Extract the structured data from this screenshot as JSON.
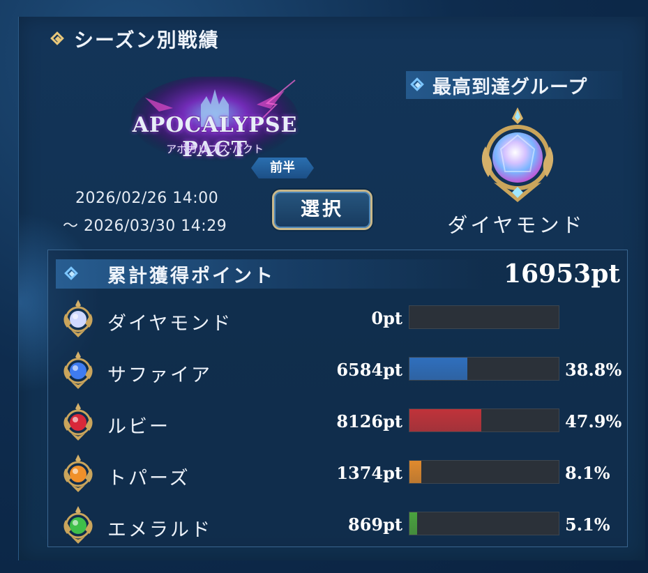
{
  "section_title": "シーズン別戦績",
  "season": {
    "logo_title": "APOCALYPSE PACT",
    "logo_subtitle": "アポカリプス·パクト",
    "half_badge": "前半",
    "start": "2026/02/26 14:00",
    "end": "～ 2026/03/30 14:29",
    "select_button": "選択"
  },
  "highest_group": {
    "label": "最高到達グループ",
    "name": "ダイヤモンド",
    "icon": "diamond-rank-emblem-icon"
  },
  "points": {
    "label": "累計獲得ポイント",
    "total": "16953pt",
    "ranks": [
      {
        "name": "ダイヤモンド",
        "points": "0pt",
        "percent": "",
        "fraction": 0.0,
        "color": "#9aa0aa",
        "gem": "#cfd8ff",
        "icon": "diamond-rank-icon"
      },
      {
        "name": "サファイア",
        "points": "6584pt",
        "percent": "38.8%",
        "fraction": 0.388,
        "color": "#2f6fbd",
        "gem": "#3f7cf0",
        "icon": "sapphire-rank-icon"
      },
      {
        "name": "ルビー",
        "points": "8126pt",
        "percent": "47.9%",
        "fraction": 0.479,
        "color": "#c0333a",
        "gem": "#d8283a",
        "icon": "ruby-rank-icon"
      },
      {
        "name": "トパーズ",
        "points": "1374pt",
        "percent": "8.1%",
        "fraction": 0.081,
        "color": "#e08a2e",
        "gem": "#f0902a",
        "icon": "topaz-rank-icon"
      },
      {
        "name": "エメラルド",
        "points": "869pt",
        "percent": "5.1%",
        "fraction": 0.051,
        "color": "#4aa23e",
        "gem": "#3fbf4a",
        "icon": "emerald-rank-icon"
      }
    ]
  }
}
